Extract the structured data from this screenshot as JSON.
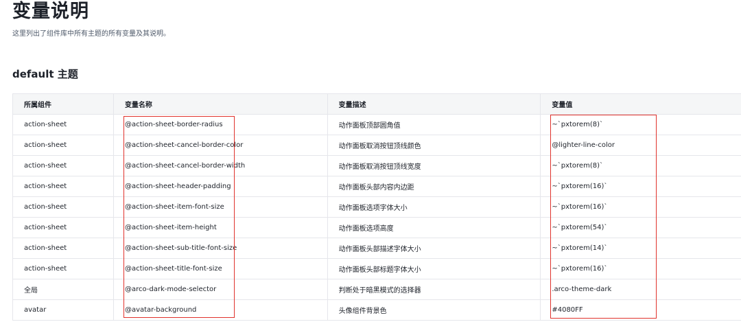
{
  "page": {
    "title": "变量说明",
    "description": "这里列出了组件库中所有主题的所有变量及其说明。",
    "section_title": "default 主题"
  },
  "table": {
    "headers": {
      "component": "所属组件",
      "name": "变量名称",
      "description": "变量描述",
      "value": "变量值"
    },
    "rows": [
      {
        "component": "action-sheet",
        "name": "@action-sheet-border-radius",
        "description": "动作面板顶部圆角值",
        "value": "~`pxtorem(8)`"
      },
      {
        "component": "action-sheet",
        "name": "@action-sheet-cancel-border-color",
        "description": "动作面板取消按钮顶线颜色",
        "value": "@lighter-line-color"
      },
      {
        "component": "action-sheet",
        "name": "@action-sheet-cancel-border-width",
        "description": "动作面板取消按钮顶线宽度",
        "value": "~`pxtorem(8)`"
      },
      {
        "component": "action-sheet",
        "name": "@action-sheet-header-padding",
        "description": "动作面板头部内容内边距",
        "value": "~`pxtorem(16)`"
      },
      {
        "component": "action-sheet",
        "name": "@action-sheet-item-font-size",
        "description": "动作面板选项字体大小",
        "value": "~`pxtorem(16)`"
      },
      {
        "component": "action-sheet",
        "name": "@action-sheet-item-height",
        "description": "动作面板选项高度",
        "value": "~`pxtorem(54)`"
      },
      {
        "component": "action-sheet",
        "name": "@action-sheet-sub-title-font-size",
        "description": "动作面板头部描述字体大小",
        "value": "~`pxtorem(14)`"
      },
      {
        "component": "action-sheet",
        "name": "@action-sheet-title-font-size",
        "description": "动作面板头部标题字体大小",
        "value": "~`pxtorem(16)`"
      },
      {
        "component": "全局",
        "name": "@arco-dark-mode-selector",
        "description": "判断处于暗黑模式的选择器",
        "value": ".arco-theme-dark"
      },
      {
        "component": "avatar",
        "name": "@avatar-background",
        "description": "头像组件背景色",
        "value": "#4080FF"
      }
    ]
  },
  "annotations": {
    "highlight_color": "#e0312b"
  }
}
